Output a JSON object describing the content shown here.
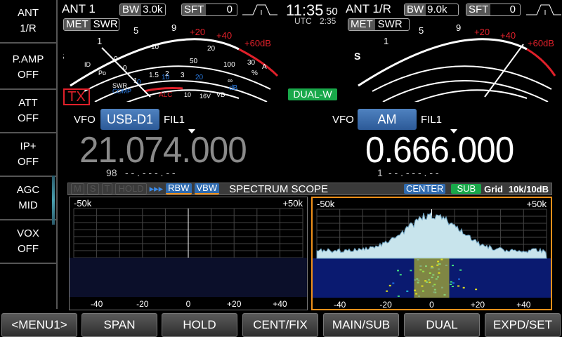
{
  "sidebar": {
    "items": [
      {
        "line1": "ANT",
        "line2": "1/R"
      },
      {
        "line1": "P.AMP",
        "line2": "OFF"
      },
      {
        "line1": "ATT",
        "line2": "OFF"
      },
      {
        "line1": "IP+",
        "line2": "OFF"
      },
      {
        "line1": "AGC",
        "line2": "MID"
      },
      {
        "line1": "VOX",
        "line2": "OFF"
      }
    ]
  },
  "clock": {
    "time": "11:35",
    "seconds": "50",
    "utc_label": "UTC",
    "utc_time": "2:35"
  },
  "main": {
    "antenna": "ANT 1",
    "bw_label": "BW",
    "bw_value": "3.0k",
    "sft_label": "SFT",
    "sft_value": "0",
    "met_label": "MET",
    "met_value": "SWR",
    "tx": "TX",
    "vfo": "VFO",
    "mode": "USB-D1",
    "filter": "FIL1",
    "frequency": "21.074.000",
    "memory": "98",
    "memo_name": "- - . - - - . - -"
  },
  "sub": {
    "antenna": "ANT 1/R",
    "bw_label": "BW",
    "bw_value": "9.0k",
    "sft_label": "SFT",
    "sft_value": "0",
    "met_label": "MET",
    "met_value": "SWR",
    "dual": "DUAL-W",
    "vfo": "VFO",
    "mode": "AM",
    "filter": "FIL1",
    "frequency": "0.666.000",
    "memory": "1",
    "memo_name": "- - . - - - . - -"
  },
  "meter": {
    "s_label": "S",
    "s_ticks": [
      "1",
      "5",
      "9"
    ],
    "over_ticks": [
      "+20",
      "+40",
      "+60dB"
    ],
    "id_label": "ID",
    "id_ticks": [
      "10",
      "20",
      "30",
      "A"
    ],
    "po_label": "Po",
    "po_ticks": [
      "0",
      "50",
      "100",
      "%"
    ],
    "swr_label": "SWR",
    "swr_ticks": [
      "1",
      "1.5",
      "2",
      "3",
      "∞"
    ],
    "comp_label": "COMP",
    "comp_ticks": [
      "0",
      "10",
      "20",
      "dB"
    ],
    "alc_label": "ALC",
    "vd_ticks": [
      "10",
      "16V",
      "VD"
    ],
    "id_zero": "0",
    "po_zero": "0"
  },
  "scope": {
    "indicators": [
      "M",
      "S",
      "T",
      "HOLD"
    ],
    "arrows": "▸▸▸",
    "rbw": "RBW",
    "vbw": "VBW",
    "title": "SPECTRUM SCOPE",
    "center": "CENTER",
    "sub": "SUB",
    "grid_label": "Grid",
    "grid_value": "10k/10dB",
    "span_left": "-50k",
    "span_right": "+50k",
    "x_ticks": [
      "-40",
      "-20",
      "0",
      "+20",
      "+40"
    ]
  },
  "buttons": [
    "<MENU1>",
    "SPAN",
    "HOLD",
    "CENT/FIX",
    "MAIN/SUB",
    "DUAL",
    "EXPD/SET"
  ],
  "colors": {
    "accent_blue": "#2f6bb0",
    "green": "#19a84a",
    "red": "#e0202a",
    "orange": "#f0901a"
  }
}
